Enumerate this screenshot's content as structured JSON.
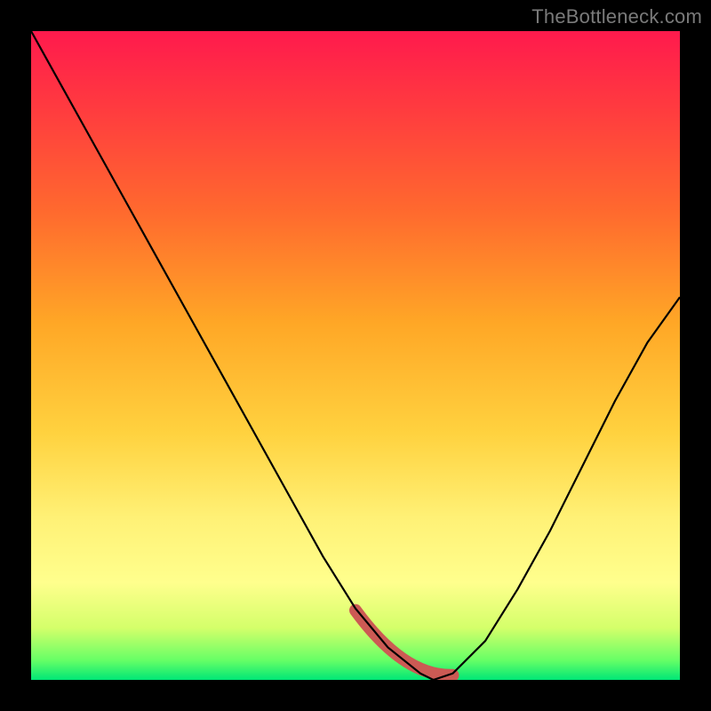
{
  "watermark": "TheBottleneck.com",
  "colors": {
    "frame": "#000000",
    "curve": "#000000",
    "valley_band": "#cc5a54",
    "gradient_stops": [
      "#ff1a4d",
      "#ff3b3f",
      "#ff6a2e",
      "#ffa726",
      "#ffd23f",
      "#fff176",
      "#ffff8d",
      "#d4ff6a",
      "#66ff66",
      "#00e676"
    ]
  },
  "chart_data": {
    "type": "line",
    "title": "",
    "xlabel": "",
    "ylabel": "",
    "xlim": [
      0,
      100
    ],
    "ylim": [
      0,
      100
    ],
    "x": [
      0,
      5,
      10,
      15,
      20,
      25,
      30,
      35,
      40,
      45,
      50,
      55,
      60,
      62,
      65,
      70,
      75,
      80,
      85,
      90,
      95,
      100
    ],
    "values": [
      100,
      91,
      82,
      73,
      64,
      55,
      46,
      37,
      28,
      19,
      11,
      5,
      1,
      0,
      1,
      6,
      14,
      23,
      33,
      43,
      52,
      59
    ],
    "optimal_range_x": [
      50,
      65
    ],
    "annotations": []
  }
}
